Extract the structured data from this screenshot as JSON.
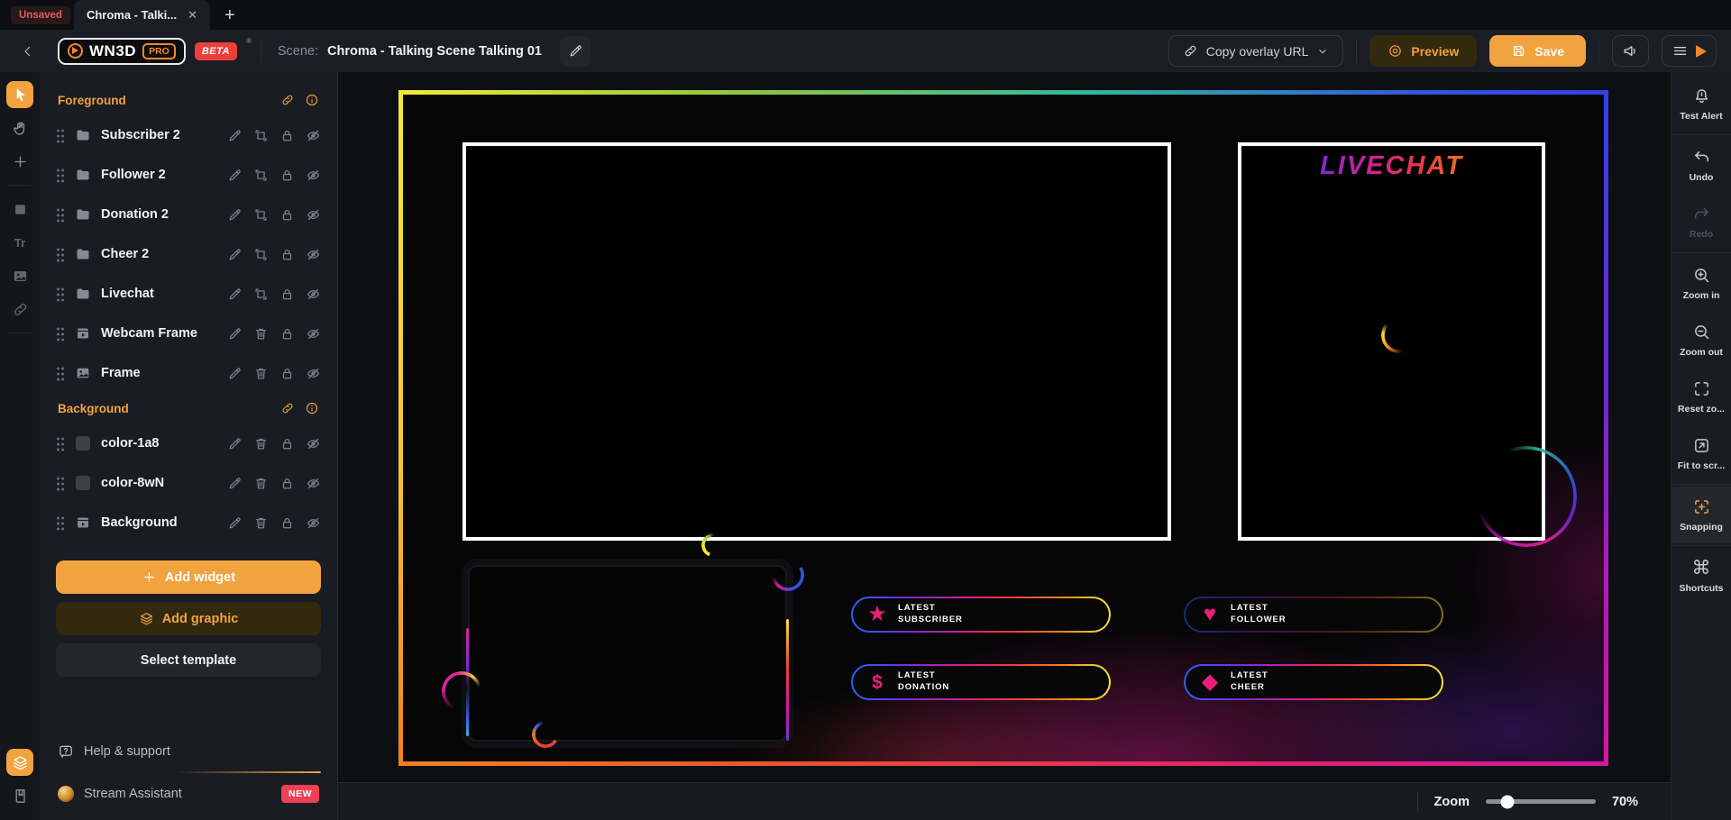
{
  "colors": {
    "accent_orange": "#f0a33f",
    "badge_red": "#ee4056",
    "canvas_pink": "#ec1e79",
    "unsaved_red": "#e25c5c"
  },
  "tab_bar": {
    "unsaved": "Unsaved",
    "tab_title": "Chroma - Talki...",
    "close": "✕",
    "new_tab": "+"
  },
  "header": {
    "logo_text": "WN3D",
    "logo_pro": "PRO",
    "logo_beta": "BETA",
    "logo_reg": "®",
    "scene_label": "Scene:",
    "scene_title": "Chroma - Talking Scene Talking 01",
    "copy_overlay_url_label": "Copy overlay URL",
    "preview_label": "Preview",
    "save_label": "Save"
  },
  "toolbar": {
    "text_tool_glyph": "Tr"
  },
  "left_panel": {
    "foreground": {
      "title": "Foreground",
      "layers": [
        {
          "name": "Subscriber 2",
          "icon": "folder"
        },
        {
          "name": "Follower 2",
          "icon": "folder"
        },
        {
          "name": "Donation 2",
          "icon": "folder"
        },
        {
          "name": "Cheer 2",
          "icon": "folder"
        },
        {
          "name": "Livechat",
          "icon": "folder"
        },
        {
          "name": "Webcam Frame",
          "icon": "widget"
        },
        {
          "name": "Frame",
          "icon": "image"
        }
      ]
    },
    "background": {
      "title": "Background",
      "layers": [
        {
          "name": "color-1a8",
          "icon": "color-swatch"
        },
        {
          "name": "color-8wN",
          "icon": "color-swatch"
        },
        {
          "name": "Background",
          "icon": "widget"
        }
      ]
    },
    "add_widget_label": "Add widget",
    "add_graphic_label": "Add graphic",
    "select_template_label": "Select template",
    "help_label": "Help & support",
    "assistant_label": "Stream Assistant",
    "assistant_badge": "NEW"
  },
  "canvas": {
    "livechat_title": "LIVECHAT",
    "widgets": [
      {
        "line1": "LATEST",
        "line2": "SUBSCRIBER",
        "icon": "star-icon",
        "icon_glyph": "★"
      },
      {
        "line1": "LATEST",
        "line2": "FOLLOWER",
        "icon": "heart-icon",
        "icon_glyph": "♥"
      },
      {
        "line1": "LATEST",
        "line2": "DONATION",
        "icon": "dollar-icon",
        "icon_glyph": "$"
      },
      {
        "line1": "LATEST",
        "line2": "CHEER",
        "icon": "diamond-icon",
        "icon_glyph": "◆"
      }
    ]
  },
  "right_sidebar": {
    "items": [
      {
        "label": "Test Alert",
        "icon": "bell"
      },
      {
        "label": "Undo",
        "icon": "undo"
      },
      {
        "label": "Redo",
        "icon": "redo",
        "disabled": true
      },
      {
        "label": "Zoom in",
        "icon": "zoom-in"
      },
      {
        "label": "Zoom out",
        "icon": "zoom-out"
      },
      {
        "label": "Reset zo...",
        "icon": "reset-zoom"
      },
      {
        "label": "Fit to scr...",
        "icon": "fit-to-screen"
      },
      {
        "label": "Snapping",
        "icon": "snapping",
        "active": true
      },
      {
        "label": "Shortcuts",
        "icon": "command"
      }
    ],
    "cmd_glyph": "⌘"
  },
  "bottom_bar": {
    "zoom_label": "Zoom",
    "zoom_value": "70%"
  }
}
